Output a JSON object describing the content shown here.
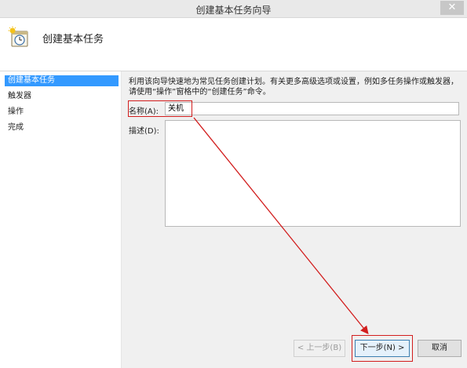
{
  "window": {
    "title": "创建基本任务向导",
    "close_glyph": "✕"
  },
  "header": {
    "heading": "创建基本任务"
  },
  "sidebar": {
    "steps": [
      {
        "label": "创建基本任务",
        "active": true
      },
      {
        "label": "触发器",
        "active": false
      },
      {
        "label": "操作",
        "active": false
      },
      {
        "label": "完成",
        "active": false
      }
    ]
  },
  "main": {
    "intro": "利用该向导快速地为常见任务创建计划。有关更多高级选项或设置，例如多任务操作或触发器，请使用“操作”窗格中的“创建任务”命令。",
    "name_label": "名称(A):",
    "name_value": "关机",
    "desc_label": "描述(D):",
    "desc_value": ""
  },
  "buttons": {
    "back": "< 上一步(B)",
    "next": "下一步(N) >",
    "cancel": "取消"
  },
  "colors": {
    "annotation": "#d21e1e",
    "selection": "#3399ff"
  }
}
